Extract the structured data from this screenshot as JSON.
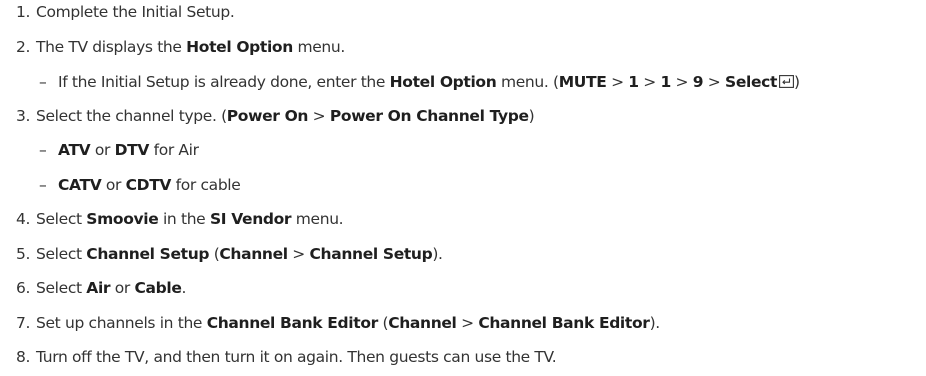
{
  "steps": [
    {
      "num": "1.",
      "parts": [
        {
          "t": "Complete the Initial Setup."
        }
      ]
    },
    {
      "num": "2.",
      "parts": [
        {
          "t": "The TV displays the "
        },
        {
          "t": "Hotel Option",
          "b": true
        },
        {
          "t": " menu."
        }
      ]
    },
    {
      "sub": true,
      "dash": "–",
      "parts": [
        {
          "t": "If the Initial Setup is already done, enter the "
        },
        {
          "t": "Hotel Option",
          "b": true
        },
        {
          "t": " menu. ("
        },
        {
          "t": "MUTE",
          "b": true
        },
        {
          "t": " > "
        },
        {
          "t": "1",
          "b": true
        },
        {
          "t": " > "
        },
        {
          "t": "1",
          "b": true
        },
        {
          "t": " > "
        },
        {
          "t": "9",
          "b": true
        },
        {
          "t": " > "
        },
        {
          "t": "Select",
          "b": true
        },
        {
          "icon": "enter-key-icon"
        },
        {
          "t": ")"
        }
      ]
    },
    {
      "num": "3.",
      "parts": [
        {
          "t": "Select the channel type. ("
        },
        {
          "t": "Power On",
          "b": true
        },
        {
          "t": " > "
        },
        {
          "t": "Power On Channel Type",
          "b": true
        },
        {
          "t": ")"
        }
      ]
    },
    {
      "sub": true,
      "dash": "–",
      "parts": [
        {
          "t": "ATV",
          "b": true
        },
        {
          "t": " or "
        },
        {
          "t": "DTV",
          "b": true
        },
        {
          "t": " for Air"
        }
      ]
    },
    {
      "sub": true,
      "dash": "–",
      "parts": [
        {
          "t": "CATV",
          "b": true
        },
        {
          "t": " or "
        },
        {
          "t": "CDTV",
          "b": true
        },
        {
          "t": " for cable"
        }
      ]
    },
    {
      "num": "4.",
      "parts": [
        {
          "t": "Select "
        },
        {
          "t": "Smoovie",
          "b": true
        },
        {
          "t": " in the "
        },
        {
          "t": "SI Vendor",
          "b": true
        },
        {
          "t": " menu."
        }
      ]
    },
    {
      "num": "5.",
      "parts": [
        {
          "t": "Select "
        },
        {
          "t": "Channel Setup",
          "b": true
        },
        {
          "t": " ("
        },
        {
          "t": "Channel",
          "b": true
        },
        {
          "t": " > "
        },
        {
          "t": "Channel Setup",
          "b": true
        },
        {
          "t": ")."
        }
      ]
    },
    {
      "num": "6.",
      "parts": [
        {
          "t": "Select "
        },
        {
          "t": "Air",
          "b": true
        },
        {
          "t": " or "
        },
        {
          "t": "Cable",
          "b": true
        },
        {
          "t": "."
        }
      ]
    },
    {
      "num": "7.",
      "parts": [
        {
          "t": "Set up channels in the "
        },
        {
          "t": "Channel Bank Editor",
          "b": true
        },
        {
          "t": " ("
        },
        {
          "t": "Channel",
          "b": true
        },
        {
          "t": " > "
        },
        {
          "t": "Channel Bank Editor",
          "b": true
        },
        {
          "t": ")."
        }
      ]
    },
    {
      "num": "8.",
      "parts": [
        {
          "t": "Turn off the TV, and then turn it on again. Then guests can use the TV."
        }
      ]
    }
  ]
}
